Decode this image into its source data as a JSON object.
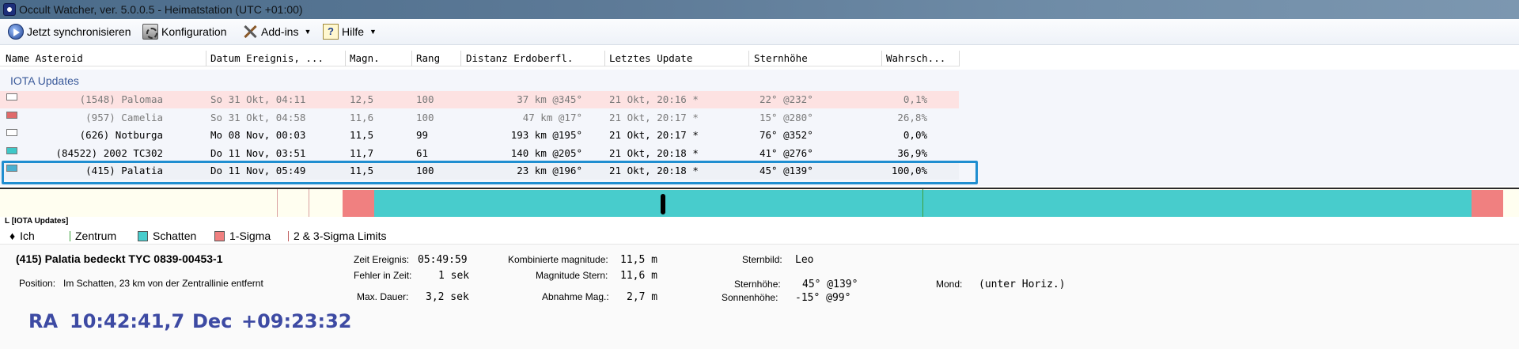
{
  "window": {
    "title": "Occult Watcher, ver. 5.0.0.5 - Heimatstation (UTC +01:00)"
  },
  "toolbar": {
    "sync_label": "Jetzt synchronisieren",
    "config_label": "Konfiguration",
    "addins_label": "Add-ins",
    "help_label": "Hilfe"
  },
  "grid": {
    "headers": [
      "Name Asteroid",
      "Datum Ereignis, ...",
      "Magn.",
      "Rang",
      "Distanz Erdoberfl.",
      "Letztes Update",
      "Sternhöhe",
      "Wahrsch..."
    ],
    "group": "IOTA Updates",
    "rows": [
      {
        "name": "(1548) Palomaa",
        "date": "So 31 Okt, 04:11",
        "mag": "12,5",
        "rank": "100",
        "dist": "37 km @345°",
        "update": "21 Okt, 20:16 *",
        "alt": "22° @232°",
        "prob": "0,1%",
        "swatch": "#ffffff",
        "bg": "#fde2e2",
        "color": "#7a7a7a"
      },
      {
        "name": "(957) Camelia",
        "date": "So 31 Okt, 04:58",
        "mag": "11,6",
        "rank": "100",
        "dist": "47 km @17°",
        "update": "21 Okt, 20:17 *",
        "alt": "15° @280°",
        "prob": "26,8%",
        "swatch": "#e06a6a",
        "bg": "transparent",
        "color": "#7a7a7a"
      },
      {
        "name": "(626) Notburga",
        "date": "Mo 08 Nov, 00:03",
        "mag": "11,5",
        "rank": "99",
        "dist": "193 km @195°",
        "update": "21 Okt, 20:17 *",
        "alt": "76° @352°",
        "prob": "0,0%",
        "swatch": "#ffffff",
        "bg": "transparent",
        "color": "#000000"
      },
      {
        "name": "(84522) 2002 TC302",
        "date": "Do 11 Nov, 03:51",
        "mag": "11,7",
        "rank": "61",
        "dist": "140 km @205°",
        "update": "21 Okt, 20:18 *",
        "alt": "41° @276°",
        "prob": "36,9%",
        "swatch": "#3fc8c8",
        "bg": "transparent",
        "color": "#000000"
      },
      {
        "name": "(415) Palatia",
        "date": "Do 11 Nov, 05:49",
        "mag": "11,5",
        "rank": "100",
        "dist": "23 km @196°",
        "update": "21 Okt, 20:18 *",
        "alt": "45° @139°",
        "prob": "100,0%",
        "swatch": "#4ab0d0",
        "bg": "#eef1f6",
        "color": "#000000"
      }
    ]
  },
  "colors": {
    "shadow": "#48cccc",
    "sigma": "#f08080",
    "center": "#3ca03c",
    "accent": "#3d4aa3",
    "selection": "#1f8ed0"
  },
  "legend": {
    "title": "L [IOTA Updates]",
    "me": "Ich",
    "center": "Zentrum",
    "shadow": "Schatten",
    "sigma": "1-Sigma",
    "limits": "2 & 3-Sigma Limits"
  },
  "details": {
    "title": "(415) Palatia bedeckt TYC 0839-00453-1",
    "position_label": "Position:",
    "position_value": "Im Schatten, 23 km von der Zentrallinie entfernt",
    "ra_label": "RA",
    "ra_value": "10:42:41,7",
    "dec_label": "Dec",
    "dec_value": "+09:23:32",
    "event_time_label": "Zeit Ereignis:",
    "event_time_value": "05:49:59",
    "time_error_label": "Fehler in Zeit:",
    "time_error_value": "1 sek",
    "max_duration_label": "Max. Dauer:",
    "max_duration_value": "3,2 sek",
    "combined_mag_label": "Kombinierte magnitude:",
    "combined_mag_value": "11,5 m",
    "star_mag_label": "Magnitude Stern:",
    "star_mag_value": "11,6 m",
    "drop_mag_label": "Abnahme Mag.:",
    "drop_mag_value": "2,7 m",
    "constellation_label": "Sternbild:",
    "constellation_value": "Leo",
    "star_alt_label": "Sternhöhe:",
    "star_alt_value": "45° @139°",
    "sun_alt_label": "Sonnenhöhe:",
    "sun_alt_value": "-15° @99°",
    "moon_label": "Mond:",
    "moon_value": "(unter Horiz.)"
  }
}
